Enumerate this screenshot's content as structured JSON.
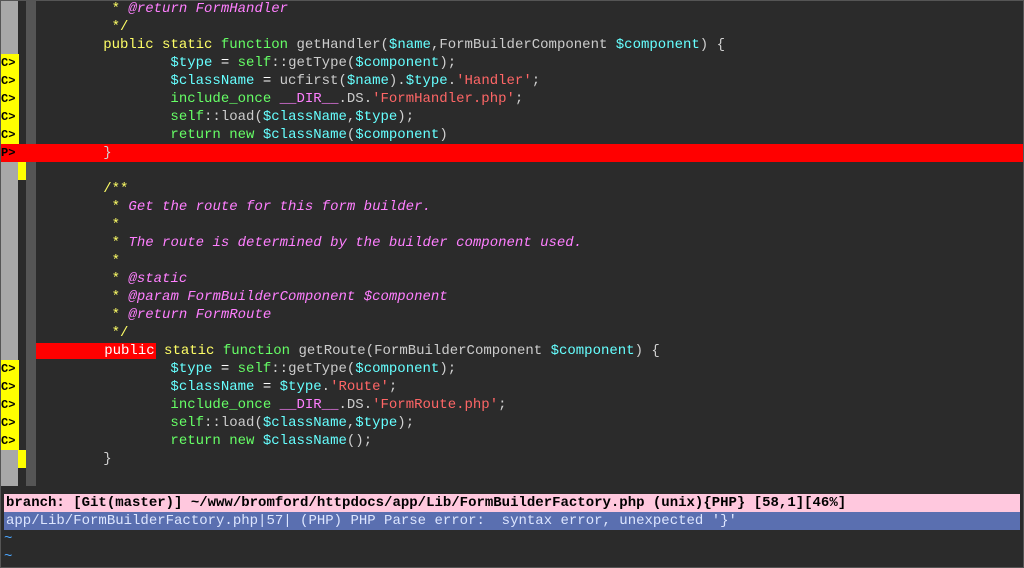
{
  "lines": [
    {
      "sign": null,
      "gBclass": "",
      "tokens": [
        {
          "txt": "         ",
          "cls": ""
        },
        {
          "txt": "*",
          "cls": "hl-commentstar"
        },
        {
          "txt": " @return FormHandler",
          "cls": "hl-comment"
        }
      ]
    },
    {
      "sign": null,
      "gBclass": "",
      "tokens": [
        {
          "txt": "         ",
          "cls": ""
        },
        {
          "txt": "*/",
          "cls": "hl-commentstar"
        }
      ]
    },
    {
      "sign": null,
      "gBclass": "",
      "tokens": [
        {
          "txt": "        ",
          "cls": ""
        },
        {
          "txt": "public",
          "cls": "hl-keyword"
        },
        {
          "txt": " ",
          "cls": ""
        },
        {
          "txt": "static",
          "cls": "hl-keyword"
        },
        {
          "txt": " ",
          "cls": ""
        },
        {
          "txt": "function",
          "cls": "hl-kw2"
        },
        {
          "txt": " ",
          "cls": ""
        },
        {
          "txt": "getHandler",
          "cls": "hl-func"
        },
        {
          "txt": "(",
          "cls": "hl-punct"
        },
        {
          "txt": "$name",
          "cls": "hl-var"
        },
        {
          "txt": ",",
          "cls": "hl-punct"
        },
        {
          "txt": "FormBuilderComponent",
          "cls": "hl-func"
        },
        {
          "txt": " ",
          "cls": ""
        },
        {
          "txt": "$component",
          "cls": "hl-var"
        },
        {
          "txt": ")",
          "cls": "hl-punct"
        },
        {
          "txt": " ",
          "cls": ""
        },
        {
          "txt": "{",
          "cls": "hl-punct"
        }
      ]
    },
    {
      "sign": {
        "txt": "C>",
        "cls": "yellow"
      },
      "gBclass": "",
      "tokens": [
        {
          "txt": "                ",
          "cls": ""
        },
        {
          "txt": "$type",
          "cls": "hl-var"
        },
        {
          "txt": " ",
          "cls": ""
        },
        {
          "txt": "=",
          "cls": "hl-op"
        },
        {
          "txt": " ",
          "cls": ""
        },
        {
          "txt": "self",
          "cls": "hl-kw2"
        },
        {
          "txt": "::",
          "cls": "hl-punct"
        },
        {
          "txt": "getType",
          "cls": "hl-func"
        },
        {
          "txt": "(",
          "cls": "hl-punct"
        },
        {
          "txt": "$component",
          "cls": "hl-var"
        },
        {
          "txt": ")",
          "cls": "hl-punct"
        },
        {
          "txt": ";",
          "cls": "hl-punct"
        }
      ]
    },
    {
      "sign": {
        "txt": "C>",
        "cls": "yellow"
      },
      "gBclass": "",
      "tokens": [
        {
          "txt": "                ",
          "cls": ""
        },
        {
          "txt": "$className",
          "cls": "hl-var"
        },
        {
          "txt": " ",
          "cls": ""
        },
        {
          "txt": "=",
          "cls": "hl-op"
        },
        {
          "txt": " ucfirst",
          "cls": "hl-func"
        },
        {
          "txt": "(",
          "cls": "hl-punct"
        },
        {
          "txt": "$name",
          "cls": "hl-var"
        },
        {
          "txt": ")",
          "cls": "hl-punct"
        },
        {
          "txt": ".",
          "cls": "hl-punct"
        },
        {
          "txt": "$type",
          "cls": "hl-var"
        },
        {
          "txt": ".",
          "cls": "hl-punct"
        },
        {
          "txt": "'Handler'",
          "cls": "hl-string"
        },
        {
          "txt": ";",
          "cls": "hl-punct"
        }
      ]
    },
    {
      "sign": {
        "txt": "C>",
        "cls": "yellow"
      },
      "gBclass": "",
      "tokens": [
        {
          "txt": "                ",
          "cls": ""
        },
        {
          "txt": "include_once",
          "cls": "hl-kw2"
        },
        {
          "txt": " ",
          "cls": ""
        },
        {
          "txt": "__DIR__",
          "cls": "hl-const"
        },
        {
          "txt": ".",
          "cls": "hl-punct"
        },
        {
          "txt": "DS",
          "cls": "hl-func"
        },
        {
          "txt": ".",
          "cls": "hl-punct"
        },
        {
          "txt": "'FormHandler.php'",
          "cls": "hl-string"
        },
        {
          "txt": ";",
          "cls": "hl-punct"
        }
      ]
    },
    {
      "sign": {
        "txt": "C>",
        "cls": "yellow"
      },
      "gBclass": "",
      "tokens": [
        {
          "txt": "                ",
          "cls": ""
        },
        {
          "txt": "self",
          "cls": "hl-kw2"
        },
        {
          "txt": "::",
          "cls": "hl-punct"
        },
        {
          "txt": "load",
          "cls": "hl-func"
        },
        {
          "txt": "(",
          "cls": "hl-punct"
        },
        {
          "txt": "$className",
          "cls": "hl-var"
        },
        {
          "txt": ",",
          "cls": "hl-punct"
        },
        {
          "txt": "$type",
          "cls": "hl-var"
        },
        {
          "txt": ")",
          "cls": "hl-punct"
        },
        {
          "txt": ";",
          "cls": "hl-punct"
        }
      ]
    },
    {
      "sign": {
        "txt": "C>",
        "cls": "yellow"
      },
      "gBclass": "",
      "tokens": [
        {
          "txt": "                ",
          "cls": ""
        },
        {
          "txt": "return",
          "cls": "hl-kw2"
        },
        {
          "txt": " ",
          "cls": ""
        },
        {
          "txt": "new",
          "cls": "hl-kw2"
        },
        {
          "txt": " ",
          "cls": ""
        },
        {
          "txt": "$className",
          "cls": "hl-var"
        },
        {
          "txt": "(",
          "cls": "hl-punct"
        },
        {
          "txt": "$component",
          "cls": "hl-var"
        },
        {
          "txt": ")",
          "cls": "hl-punct"
        }
      ]
    },
    {
      "sign": {
        "txt": "P>",
        "cls": "red"
      },
      "gBclass": "",
      "err": true,
      "tokens": [
        {
          "txt": "        }",
          "cls": "hl-punct"
        }
      ]
    },
    {
      "sign": null,
      "gBclass": "chg",
      "tokens": []
    },
    {
      "sign": null,
      "gBclass": "",
      "tokens": [
        {
          "txt": "        ",
          "cls": ""
        },
        {
          "txt": "/**",
          "cls": "hl-commentstar"
        }
      ]
    },
    {
      "sign": null,
      "gBclass": "",
      "tokens": [
        {
          "txt": "         ",
          "cls": ""
        },
        {
          "txt": "*",
          "cls": "hl-commentstar"
        },
        {
          "txt": " Get the route for this form builder.",
          "cls": "hl-comment"
        }
      ]
    },
    {
      "sign": null,
      "gBclass": "",
      "tokens": [
        {
          "txt": "         ",
          "cls": ""
        },
        {
          "txt": "*",
          "cls": "hl-commentstar"
        }
      ]
    },
    {
      "sign": null,
      "gBclass": "",
      "tokens": [
        {
          "txt": "         ",
          "cls": ""
        },
        {
          "txt": "*",
          "cls": "hl-commentstar"
        },
        {
          "txt": " The route is determined by the builder component used.",
          "cls": "hl-comment"
        }
      ]
    },
    {
      "sign": null,
      "gBclass": "",
      "tokens": [
        {
          "txt": "         ",
          "cls": ""
        },
        {
          "txt": "*",
          "cls": "hl-commentstar"
        }
      ]
    },
    {
      "sign": null,
      "gBclass": "",
      "tokens": [
        {
          "txt": "         ",
          "cls": ""
        },
        {
          "txt": "*",
          "cls": "hl-commentstar"
        },
        {
          "txt": " @static",
          "cls": "hl-comment"
        }
      ]
    },
    {
      "sign": null,
      "gBclass": "",
      "tokens": [
        {
          "txt": "         ",
          "cls": ""
        },
        {
          "txt": "*",
          "cls": "hl-commentstar"
        },
        {
          "txt": " @param FormBuilderComponent $component",
          "cls": "hl-comment"
        }
      ]
    },
    {
      "sign": null,
      "gBclass": "",
      "tokens": [
        {
          "txt": "         ",
          "cls": ""
        },
        {
          "txt": "*",
          "cls": "hl-commentstar"
        },
        {
          "txt": " @return FormRoute",
          "cls": "hl-comment"
        }
      ]
    },
    {
      "sign": null,
      "gBclass": "",
      "tokens": [
        {
          "txt": "         ",
          "cls": ""
        },
        {
          "txt": "*/",
          "cls": "hl-commentstar"
        }
      ]
    },
    {
      "sign": null,
      "gBclass": "",
      "selPrefix": true,
      "tokens": [
        {
          "txt": "public",
          "cls": "sel-public"
        },
        {
          "txt": " ",
          "cls": ""
        },
        {
          "txt": "static",
          "cls": "hl-keyword"
        },
        {
          "txt": " ",
          "cls": ""
        },
        {
          "txt": "function",
          "cls": "hl-kw2"
        },
        {
          "txt": " ",
          "cls": ""
        },
        {
          "txt": "getRoute",
          "cls": "hl-func"
        },
        {
          "txt": "(",
          "cls": "hl-punct"
        },
        {
          "txt": "FormBuilderComponent",
          "cls": "hl-func"
        },
        {
          "txt": " ",
          "cls": ""
        },
        {
          "txt": "$component",
          "cls": "hl-var"
        },
        {
          "txt": ")",
          "cls": "hl-punct"
        },
        {
          "txt": " ",
          "cls": ""
        },
        {
          "txt": "{",
          "cls": "hl-punct"
        }
      ]
    },
    {
      "sign": {
        "txt": "C>",
        "cls": "yellow"
      },
      "gBclass": "",
      "tokens": [
        {
          "txt": "                ",
          "cls": ""
        },
        {
          "txt": "$type",
          "cls": "hl-var"
        },
        {
          "txt": " ",
          "cls": ""
        },
        {
          "txt": "=",
          "cls": "hl-op"
        },
        {
          "txt": " ",
          "cls": ""
        },
        {
          "txt": "self",
          "cls": "hl-kw2"
        },
        {
          "txt": "::",
          "cls": "hl-punct"
        },
        {
          "txt": "getType",
          "cls": "hl-func"
        },
        {
          "txt": "(",
          "cls": "hl-punct"
        },
        {
          "txt": "$component",
          "cls": "hl-var"
        },
        {
          "txt": ")",
          "cls": "hl-punct"
        },
        {
          "txt": ";",
          "cls": "hl-punct"
        }
      ]
    },
    {
      "sign": {
        "txt": "C>",
        "cls": "yellow"
      },
      "gBclass": "",
      "tokens": [
        {
          "txt": "                ",
          "cls": ""
        },
        {
          "txt": "$className",
          "cls": "hl-var"
        },
        {
          "txt": " ",
          "cls": ""
        },
        {
          "txt": "=",
          "cls": "hl-op"
        },
        {
          "txt": " ",
          "cls": ""
        },
        {
          "txt": "$type",
          "cls": "hl-var"
        },
        {
          "txt": ".",
          "cls": "hl-punct"
        },
        {
          "txt": "'Route'",
          "cls": "hl-string"
        },
        {
          "txt": ";",
          "cls": "hl-punct"
        }
      ]
    },
    {
      "sign": {
        "txt": "C>",
        "cls": "yellow"
      },
      "gBclass": "",
      "tokens": [
        {
          "txt": "                ",
          "cls": ""
        },
        {
          "txt": "include_once",
          "cls": "hl-kw2"
        },
        {
          "txt": " ",
          "cls": ""
        },
        {
          "txt": "__DIR__",
          "cls": "hl-const"
        },
        {
          "txt": ".",
          "cls": "hl-punct"
        },
        {
          "txt": "DS",
          "cls": "hl-func"
        },
        {
          "txt": ".",
          "cls": "hl-punct"
        },
        {
          "txt": "'FormRoute.php'",
          "cls": "hl-string"
        },
        {
          "txt": ";",
          "cls": "hl-punct"
        }
      ]
    },
    {
      "sign": {
        "txt": "C>",
        "cls": "yellow"
      },
      "gBclass": "",
      "tokens": [
        {
          "txt": "                ",
          "cls": ""
        },
        {
          "txt": "self",
          "cls": "hl-kw2"
        },
        {
          "txt": "::",
          "cls": "hl-punct"
        },
        {
          "txt": "load",
          "cls": "hl-func"
        },
        {
          "txt": "(",
          "cls": "hl-punct"
        },
        {
          "txt": "$className",
          "cls": "hl-var"
        },
        {
          "txt": ",",
          "cls": "hl-punct"
        },
        {
          "txt": "$type",
          "cls": "hl-var"
        },
        {
          "txt": ")",
          "cls": "hl-punct"
        },
        {
          "txt": ";",
          "cls": "hl-punct"
        }
      ]
    },
    {
      "sign": {
        "txt": "C>",
        "cls": "yellow"
      },
      "gBclass": "",
      "tokens": [
        {
          "txt": "                ",
          "cls": ""
        },
        {
          "txt": "return",
          "cls": "hl-kw2"
        },
        {
          "txt": " ",
          "cls": ""
        },
        {
          "txt": "new",
          "cls": "hl-kw2"
        },
        {
          "txt": " ",
          "cls": ""
        },
        {
          "txt": "$className",
          "cls": "hl-var"
        },
        {
          "txt": "()",
          "cls": "hl-punct"
        },
        {
          "txt": ";",
          "cls": "hl-punct"
        }
      ]
    },
    {
      "sign": null,
      "gBclass": "chg",
      "tokens": [
        {
          "txt": "        }",
          "cls": "hl-punct"
        }
      ]
    },
    {
      "sign": null,
      "gBclass": "",
      "tokens": []
    }
  ],
  "status1": "branch: [Git(master)] ~/www/bromford/httpdocs/app/Lib/FormBuilderFactory.php (unix){PHP} [58,1][46%]",
  "status2": "app/Lib/FormBuilderFactory.php|57| (PHP) PHP Parse error:  syntax error, unexpected '}'",
  "tilde": "~"
}
